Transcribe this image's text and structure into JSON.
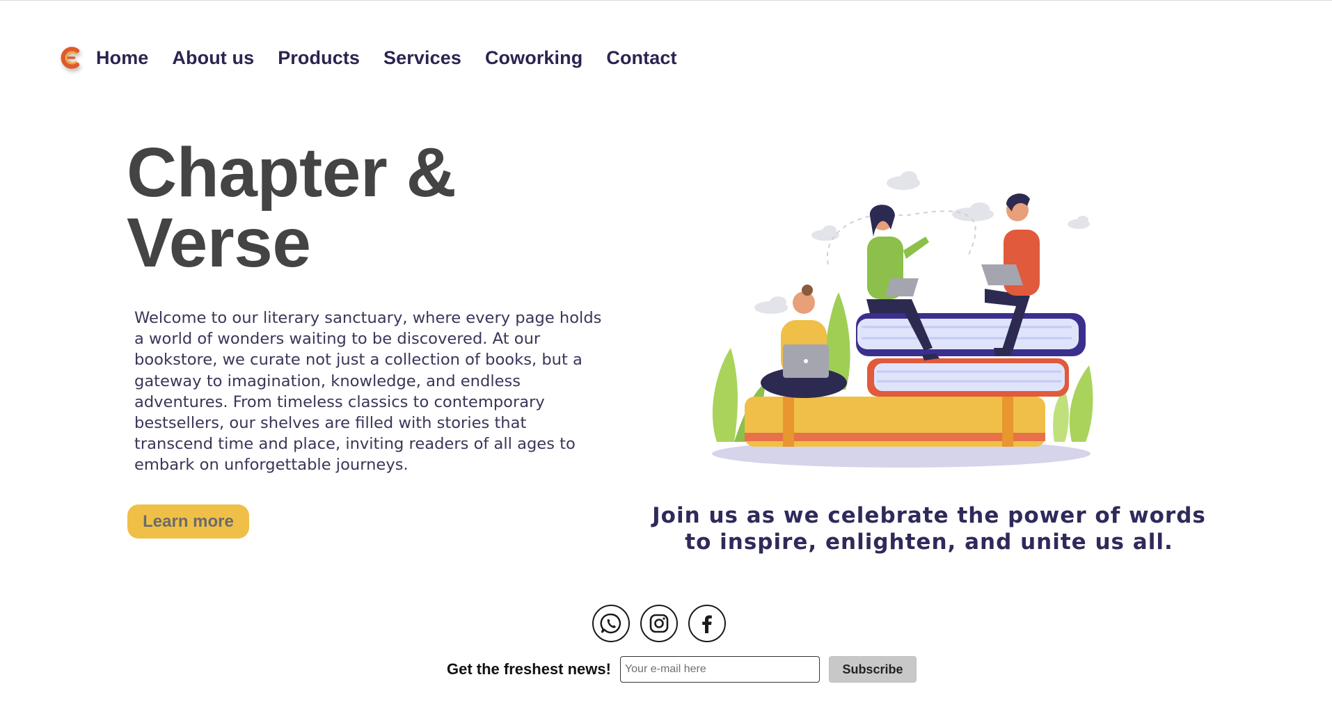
{
  "nav": {
    "logo_icon": "brand-c-logo-icon",
    "items": [
      {
        "label": "Home"
      },
      {
        "label": "About us"
      },
      {
        "label": "Products"
      },
      {
        "label": "Services"
      },
      {
        "label": "Coworking"
      },
      {
        "label": "Contact"
      }
    ]
  },
  "hero": {
    "title_line1": "Chapter &",
    "title_line2": "Verse",
    "description": "Welcome to our literary sanctuary, where every page holds a world of wonders waiting to be discovered. At our bookstore, we curate not just a collection of books, but a gateway to imagination, knowledge, and endless adventures. From timeless classics to contemporary bestsellers, our shelves are filled with stories that transcend time and place, inviting readers of all ages to embark on unforgettable journeys.",
    "cta_label": "Learn more",
    "illustration": "people-reading-on-books-illustration"
  },
  "tagline": "Join us as we celebrate the power of words to inspire, enlighten, and unite us all.",
  "social": {
    "icons": [
      "whatsapp-icon",
      "instagram-icon",
      "facebook-icon"
    ]
  },
  "newsletter": {
    "label": "Get the freshest news!",
    "placeholder": "Your e-mail here",
    "button_label": "Subscribe"
  },
  "colors": {
    "nav_text": "#2b2450",
    "title": "#444444",
    "accent_button": "#f0bf47",
    "tagline": "#2e2a5a",
    "subscribe_bg": "#c8c8c8"
  }
}
